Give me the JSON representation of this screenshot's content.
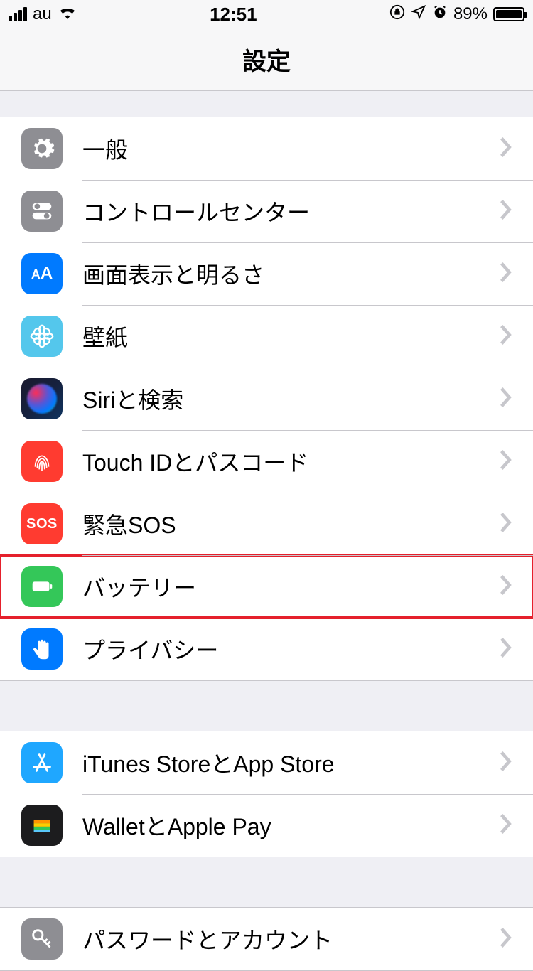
{
  "status": {
    "carrier": "au",
    "time": "12:51",
    "battery_percent": "89%"
  },
  "nav": {
    "title": "設定"
  },
  "groups": [
    {
      "items": [
        {
          "key": "general",
          "label": "一般",
          "icon": "gear-icon"
        },
        {
          "key": "control-center",
          "label": "コントロールセンター",
          "icon": "toggles-icon"
        },
        {
          "key": "display",
          "label": "画面表示と明るさ",
          "icon": "aa-icon"
        },
        {
          "key": "wallpaper",
          "label": "壁紙",
          "icon": "flower-icon"
        },
        {
          "key": "siri",
          "label": "Siriと検索",
          "icon": "siri-icon"
        },
        {
          "key": "touchid",
          "label": "Touch IDとパスコード",
          "icon": "fingerprint-icon"
        },
        {
          "key": "sos",
          "label": "緊急SOS",
          "icon": "sos-icon"
        },
        {
          "key": "battery",
          "label": "バッテリー",
          "icon": "battery-icon",
          "highlighted": true
        },
        {
          "key": "privacy",
          "label": "プライバシー",
          "icon": "hand-icon"
        }
      ]
    },
    {
      "items": [
        {
          "key": "itunes",
          "label": "iTunes StoreとApp Store",
          "icon": "appstore-icon"
        },
        {
          "key": "wallet",
          "label": "WalletとApple Pay",
          "icon": "wallet-icon"
        }
      ]
    },
    {
      "items": [
        {
          "key": "passwords",
          "label": "パスワードとアカウント",
          "icon": "key-icon"
        }
      ]
    }
  ]
}
